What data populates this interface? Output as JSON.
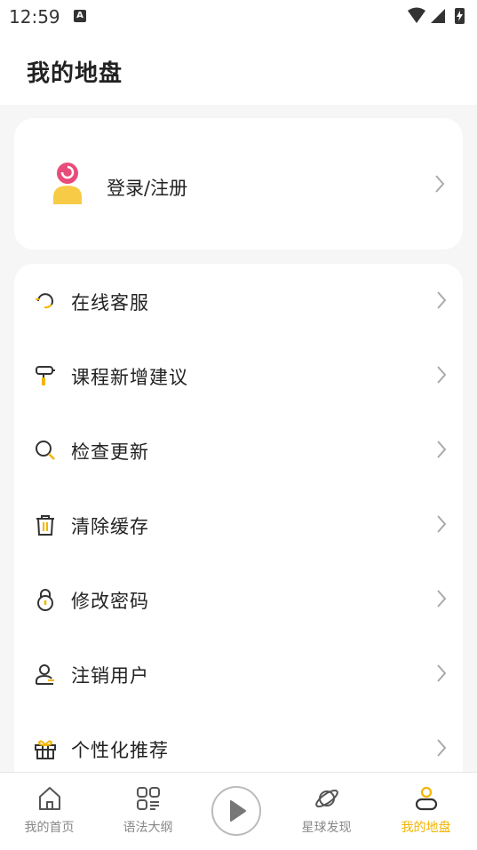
{
  "status_bar": {
    "time": "12:59",
    "badge": "A"
  },
  "header": {
    "title": "我的地盘"
  },
  "login": {
    "label": "登录/注册"
  },
  "menu": {
    "items": [
      {
        "label": "在线客服",
        "icon": "headset-icon"
      },
      {
        "label": "课程新增建议",
        "icon": "paint-roller-icon"
      },
      {
        "label": "检查更新",
        "icon": "search-icon"
      },
      {
        "label": "清除缓存",
        "icon": "trash-icon"
      },
      {
        "label": "修改密码",
        "icon": "lock-icon"
      },
      {
        "label": "注销用户",
        "icon": "user-icon"
      },
      {
        "label": "个性化推荐",
        "icon": "gift-icon"
      }
    ]
  },
  "tabbar": {
    "tabs": [
      {
        "label": "我的首页",
        "icon": "home-icon",
        "active": false
      },
      {
        "label": "语法大纲",
        "icon": "grid-list-icon",
        "active": false
      },
      {
        "label": "",
        "icon": "play-icon",
        "active": false
      },
      {
        "label": "星球发现",
        "icon": "planet-icon",
        "active": false
      },
      {
        "label": "我的地盘",
        "icon": "profile-icon",
        "active": true
      }
    ]
  },
  "colors": {
    "accent": "#f3b400",
    "avatar_pink": "#e84d7a",
    "avatar_yellow": "#f7cb45"
  }
}
